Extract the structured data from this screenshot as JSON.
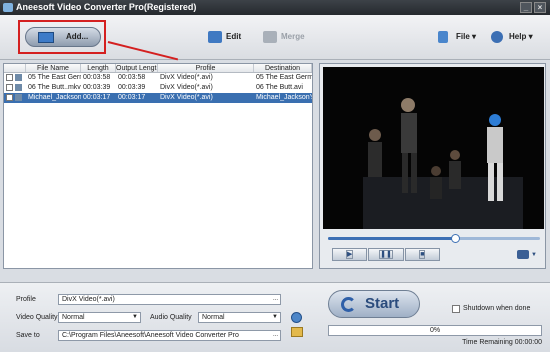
{
  "window": {
    "title": "Aneesoft Video Converter Pro(Registered)",
    "minimize": "_",
    "close": "×"
  },
  "toolbar": {
    "add_label": "Add...",
    "edit_label": "Edit",
    "merge_label": "Merge",
    "file_label": "File",
    "help_label": "Help"
  },
  "file_list": {
    "columns": [
      "File Name",
      "Length",
      "Output Length",
      "Profile",
      "Destination"
    ],
    "rows": [
      {
        "name": "05 The East Germ",
        "length": "00:03:58",
        "output_length": "00:03:58",
        "profile": "DivX Video(*.avi)",
        "destination": "05 The East Germa",
        "selected": false
      },
      {
        "name": "06 The Butt..mkv",
        "length": "00:03:39",
        "output_length": "00:03:39",
        "profile": "DivX Video(*.avi)",
        "destination": "06 The Butt.avi",
        "selected": false
      },
      {
        "name": "Michael_Jackson'",
        "length": "00:03:17",
        "output_length": "00:03:17",
        "profile": "DivX Video(*.avi)",
        "destination": "Michael_Jackson's",
        "selected": true
      }
    ]
  },
  "player": {
    "seek_progress": 0.6
  },
  "settings": {
    "profile_label": "Profile",
    "profile_value": "DivX Video(*.avi)",
    "browse": "...",
    "video_quality_label": "Video Quality",
    "video_quality_value": "Normal",
    "audio_quality_label": "Audio Quality",
    "audio_quality_value": "Normal",
    "save_to_label": "Save to",
    "save_to_value": "C:\\Program Files\\Aneesoft\\Aneesoft Video Converter Pro"
  },
  "convert": {
    "start_label": "Start",
    "shutdown_label": "Shutdown when done",
    "progress_text": "0%",
    "progress": 0,
    "time_remaining": "Time Remaining 00:00:00"
  },
  "colors": {
    "accent": "#3a6fb0",
    "highlight": "#d42020"
  }
}
